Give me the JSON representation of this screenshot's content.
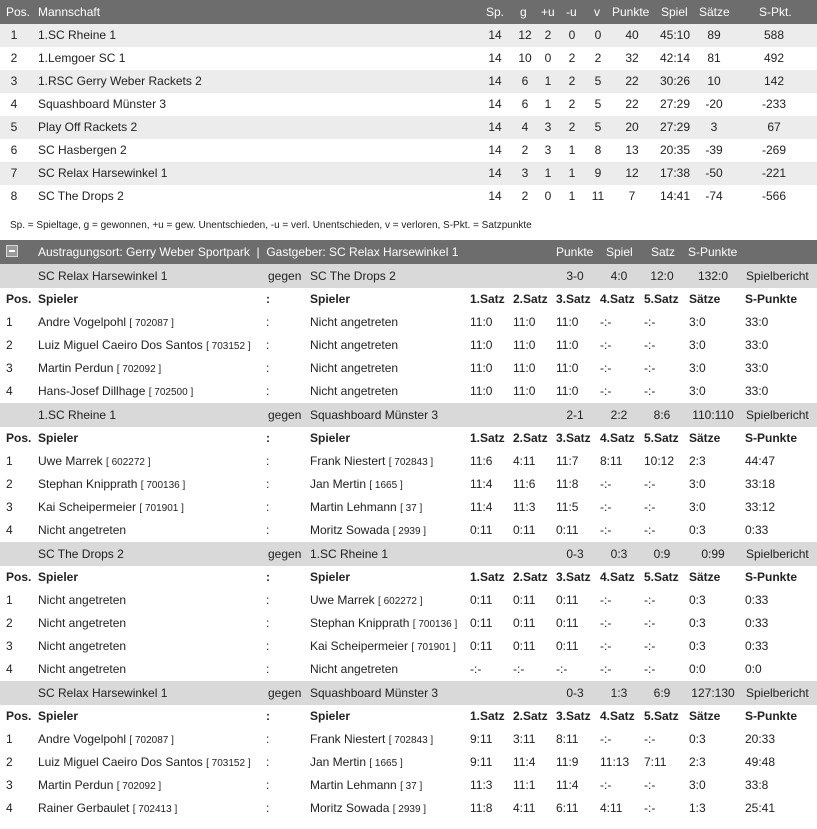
{
  "standings": {
    "headers": {
      "pos": "Pos.",
      "team": "Mannschaft",
      "sp": "Sp.",
      "g": "g",
      "pu": "+u",
      "mu": "-u",
      "v": "v",
      "punkte": "Punkte",
      "spiel": "Spiel",
      "saetze": "Sätze",
      "spkt": "S-Pkt."
    },
    "rows": [
      {
        "pos": "1",
        "team": "1.SC Rheine 1",
        "sp": "14",
        "g": "12",
        "pu": "2",
        "mu": "0",
        "v": "0",
        "punkte": "40",
        "spiel": "45:10",
        "saetze": "89",
        "spkt": "588"
      },
      {
        "pos": "2",
        "team": "1.Lemgoer SC 1",
        "sp": "14",
        "g": "10",
        "pu": "0",
        "mu": "2",
        "v": "2",
        "punkte": "32",
        "spiel": "42:14",
        "saetze": "81",
        "spkt": "492"
      },
      {
        "pos": "3",
        "team": "1.RSC Gerry Weber Rackets 2",
        "sp": "14",
        "g": "6",
        "pu": "1",
        "mu": "2",
        "v": "5",
        "punkte": "22",
        "spiel": "30:26",
        "saetze": "10",
        "spkt": "142"
      },
      {
        "pos": "4",
        "team": "Squashboard Münster 3",
        "sp": "14",
        "g": "6",
        "pu": "1",
        "mu": "2",
        "v": "5",
        "punkte": "22",
        "spiel": "27:29",
        "saetze": "-20",
        "spkt": "-233"
      },
      {
        "pos": "5",
        "team": "Play Off Rackets 2",
        "sp": "14",
        "g": "4",
        "pu": "3",
        "mu": "2",
        "v": "5",
        "punkte": "20",
        "spiel": "27:29",
        "saetze": "3",
        "spkt": "67"
      },
      {
        "pos": "6",
        "team": "SC Hasbergen 2",
        "sp": "14",
        "g": "2",
        "pu": "3",
        "mu": "1",
        "v": "8",
        "punkte": "13",
        "spiel": "20:35",
        "saetze": "-39",
        "spkt": "-269"
      },
      {
        "pos": "7",
        "team": "SC Relax Harsewinkel 1",
        "sp": "14",
        "g": "3",
        "pu": "1",
        "mu": "1",
        "v": "9",
        "punkte": "12",
        "spiel": "17:38",
        "saetze": "-50",
        "spkt": "-221"
      },
      {
        "pos": "8",
        "team": "SC The Drops 2",
        "sp": "14",
        "g": "2",
        "pu": "0",
        "mu": "1",
        "v": "11",
        "punkte": "7",
        "spiel": "14:41",
        "saetze": "-74",
        "spkt": "-566"
      }
    ],
    "legend": "Sp. = Spieltage, g = gewonnen, +u = gew. Unentschieden, -u = verl. Unentschieden, v = verloren, S-Pkt. = Satzpunkte"
  },
  "results": {
    "header": {
      "venue": "Austragungsort: Gerry Weber Sportpark  |  Gastgeber: SC Relax Harsewinkel 1",
      "punkte": "Punkte",
      "spiel": "Spiel",
      "satz": "Satz",
      "spunkte": "S-Punkte"
    },
    "col_headers": {
      "pos": "Pos.",
      "spieler1": "Spieler",
      "colon": ":",
      "spieler2": "Spieler",
      "s1": "1.Satz",
      "s2": "2.Satz",
      "s3": "3.Satz",
      "s4": "4.Satz",
      "s5": "5.Satz",
      "saetze": "Sätze",
      "spunkte": "S-Punkte"
    },
    "matches": [
      {
        "home": "SC Relax Harsewinkel 1",
        "vs": "gegen",
        "away": "SC The Drops 2",
        "punkte": "3-0",
        "spiel": "4:0",
        "satz": "12:0",
        "spunkte": "132:0",
        "bericht": "Spielbericht",
        "games": [
          {
            "pos": "1",
            "p1": "Andre Vogelpohl",
            "p1id": "[ 702087 ]",
            "colon": ":",
            "p2": "Nicht angetreten",
            "p2id": "",
            "s1": "11:0",
            "s2": "11:0",
            "s3": "11:0",
            "s4": "-:-",
            "s5": "-:-",
            "saetze": "3:0",
            "sp": "33:0"
          },
          {
            "pos": "2",
            "p1": "Luiz Miguel Caeiro Dos Santos",
            "p1id": "[ 703152 ]",
            "colon": ":",
            "p2": "Nicht angetreten",
            "p2id": "",
            "s1": "11:0",
            "s2": "11:0",
            "s3": "11:0",
            "s4": "-:-",
            "s5": "-:-",
            "saetze": "3:0",
            "sp": "33:0"
          },
          {
            "pos": "3",
            "p1": "Martin Perdun",
            "p1id": "[ 702092 ]",
            "colon": ":",
            "p2": "Nicht angetreten",
            "p2id": "",
            "s1": "11:0",
            "s2": "11:0",
            "s3": "11:0",
            "s4": "-:-",
            "s5": "-:-",
            "saetze": "3:0",
            "sp": "33:0"
          },
          {
            "pos": "4",
            "p1": "Hans-Josef Dillhage",
            "p1id": "[ 702500 ]",
            "colon": ":",
            "p2": "Nicht angetreten",
            "p2id": "",
            "s1": "11:0",
            "s2": "11:0",
            "s3": "11:0",
            "s4": "-:-",
            "s5": "-:-",
            "saetze": "3:0",
            "sp": "33:0"
          }
        ]
      },
      {
        "home": "1.SC Rheine 1",
        "vs": "gegen",
        "away": "Squashboard Münster 3",
        "punkte": "2-1",
        "spiel": "2:2",
        "satz": "8:6",
        "spunkte": "110:110",
        "bericht": "Spielbericht",
        "games": [
          {
            "pos": "1",
            "p1": "Uwe Marrek",
            "p1id": "[ 602272 ]",
            "colon": ":",
            "p2": "Frank Niestert",
            "p2id": "[ 702843 ]",
            "s1": "11:6",
            "s2": "4:11",
            "s3": "11:7",
            "s4": "8:11",
            "s5": "10:12",
            "saetze": "2:3",
            "sp": "44:47"
          },
          {
            "pos": "2",
            "p1": "Stephan Knipprath",
            "p1id": "[ 700136 ]",
            "colon": ":",
            "p2": "Jan Mertin",
            "p2id": "[ 1665 ]",
            "s1": "11:4",
            "s2": "11:6",
            "s3": "11:8",
            "s4": "-:-",
            "s5": "-:-",
            "saetze": "3:0",
            "sp": "33:18"
          },
          {
            "pos": "3",
            "p1": "Kai Scheipermeier",
            "p1id": "[ 701901 ]",
            "colon": ":",
            "p2": "Martin Lehmann",
            "p2id": "[ 37 ]",
            "s1": "11:4",
            "s2": "11:3",
            "s3": "11:5",
            "s4": "-:-",
            "s5": "-:-",
            "saetze": "3:0",
            "sp": "33:12"
          },
          {
            "pos": "4",
            "p1": "Nicht angetreten",
            "p1id": "",
            "colon": ":",
            "p2": "Moritz Sowada",
            "p2id": "[ 2939 ]",
            "s1": "0:11",
            "s2": "0:11",
            "s3": "0:11",
            "s4": "-:-",
            "s5": "-:-",
            "saetze": "0:3",
            "sp": "0:33"
          }
        ]
      },
      {
        "home": "SC The Drops 2",
        "vs": "gegen",
        "away": "1.SC Rheine 1",
        "punkte": "0-3",
        "spiel": "0:3",
        "satz": "0:9",
        "spunkte": "0:99",
        "bericht": "Spielbericht",
        "games": [
          {
            "pos": "1",
            "p1": "Nicht angetreten",
            "p1id": "",
            "colon": ":",
            "p2": "Uwe Marrek",
            "p2id": "[ 602272 ]",
            "s1": "0:11",
            "s2": "0:11",
            "s3": "0:11",
            "s4": "-:-",
            "s5": "-:-",
            "saetze": "0:3",
            "sp": "0:33"
          },
          {
            "pos": "2",
            "p1": "Nicht angetreten",
            "p1id": "",
            "colon": ":",
            "p2": "Stephan Knipprath",
            "p2id": "[ 700136 ]",
            "s1": "0:11",
            "s2": "0:11",
            "s3": "0:11",
            "s4": "-:-",
            "s5": "-:-",
            "saetze": "0:3",
            "sp": "0:33"
          },
          {
            "pos": "3",
            "p1": "Nicht angetreten",
            "p1id": "",
            "colon": ":",
            "p2": "Kai Scheipermeier",
            "p2id": "[ 701901 ]",
            "s1": "0:11",
            "s2": "0:11",
            "s3": "0:11",
            "s4": "-:-",
            "s5": "-:-",
            "saetze": "0:3",
            "sp": "0:33"
          },
          {
            "pos": "4",
            "p1": "Nicht angetreten",
            "p1id": "",
            "colon": ":",
            "p2": "Nicht angetreten",
            "p2id": "",
            "s1": "-:-",
            "s2": "-:-",
            "s3": "-:-",
            "s4": "-:-",
            "s5": "-:-",
            "saetze": "0:0",
            "sp": "0:0"
          }
        ]
      },
      {
        "home": "SC Relax Harsewinkel 1",
        "vs": "gegen",
        "away": "Squashboard Münster 3",
        "punkte": "0-3",
        "spiel": "1:3",
        "satz": "6:9",
        "spunkte": "127:130",
        "bericht": "Spielbericht",
        "games": [
          {
            "pos": "1",
            "p1": "Andre Vogelpohl",
            "p1id": "[ 702087 ]",
            "colon": ":",
            "p2": "Frank Niestert",
            "p2id": "[ 702843 ]",
            "s1": "9:11",
            "s2": "3:11",
            "s3": "8:11",
            "s4": "-:-",
            "s5": "-:-",
            "saetze": "0:3",
            "sp": "20:33"
          },
          {
            "pos": "2",
            "p1": "Luiz Miguel Caeiro Dos Santos",
            "p1id": "[ 703152 ]",
            "colon": ":",
            "p2": "Jan Mertin",
            "p2id": "[ 1665 ]",
            "s1": "9:11",
            "s2": "11:4",
            "s3": "11:9",
            "s4": "11:13",
            "s5": "7:11",
            "saetze": "2:3",
            "sp": "49:48"
          },
          {
            "pos": "3",
            "p1": "Martin Perdun",
            "p1id": "[ 702092 ]",
            "colon": ":",
            "p2": "Martin Lehmann",
            "p2id": "[ 37 ]",
            "s1": "11:3",
            "s2": "11:1",
            "s3": "11:4",
            "s4": "-:-",
            "s5": "-:-",
            "saetze": "3:0",
            "sp": "33:8"
          },
          {
            "pos": "4",
            "p1": "Rainer Gerbaulet",
            "p1id": "[ 702413 ]",
            "colon": ":",
            "p2": "Moritz Sowada",
            "p2id": "[ 2939 ]",
            "s1": "11:8",
            "s2": "4:11",
            "s3": "6:11",
            "s4": "4:11",
            "s5": "-:-",
            "saetze": "1:3",
            "sp": "25:41"
          }
        ]
      }
    ]
  }
}
